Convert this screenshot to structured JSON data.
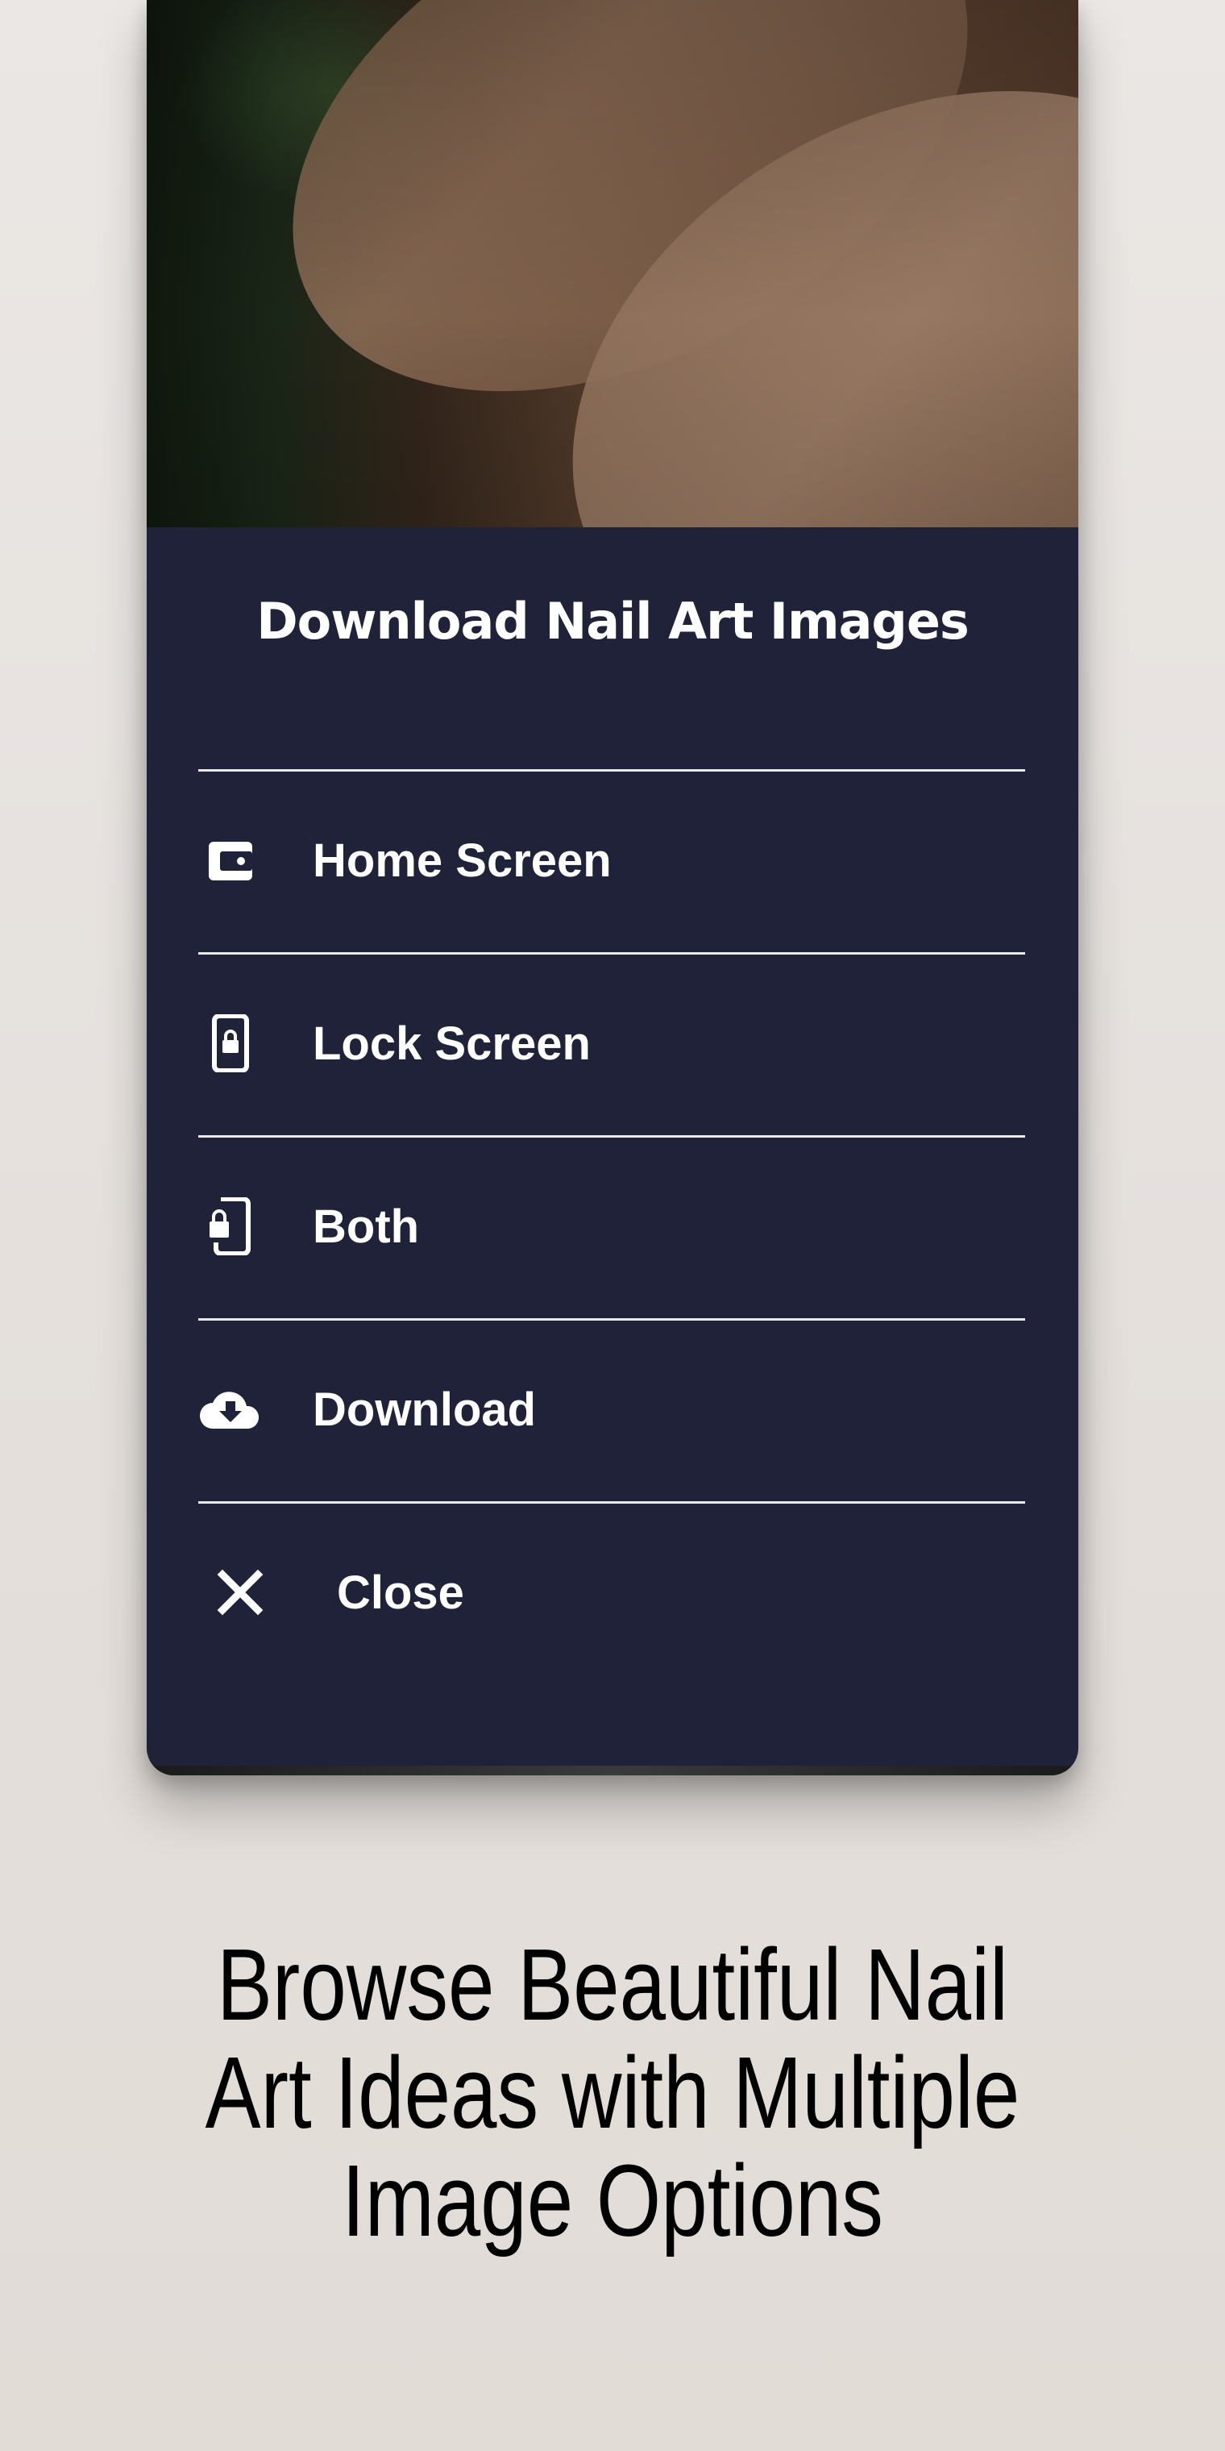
{
  "dialog": {
    "title": "Download Nail Art Images",
    "options": [
      {
        "label": "Home Screen",
        "icon": "wallpaper-icon"
      },
      {
        "label": "Lock Screen",
        "icon": "phone-lock-icon"
      },
      {
        "label": "Both",
        "icon": "phone-lock-side-icon"
      },
      {
        "label": "Download",
        "icon": "cloud-download-icon"
      },
      {
        "label": "Close",
        "icon": "close-icon"
      }
    ]
  },
  "caption": {
    "text": "Browse Beautiful Nail Art Ideas with Multiple Image Options"
  },
  "colors": {
    "sheet_background": "#1f2238",
    "text": "#ffffff",
    "page_background": "#e8e3df"
  }
}
